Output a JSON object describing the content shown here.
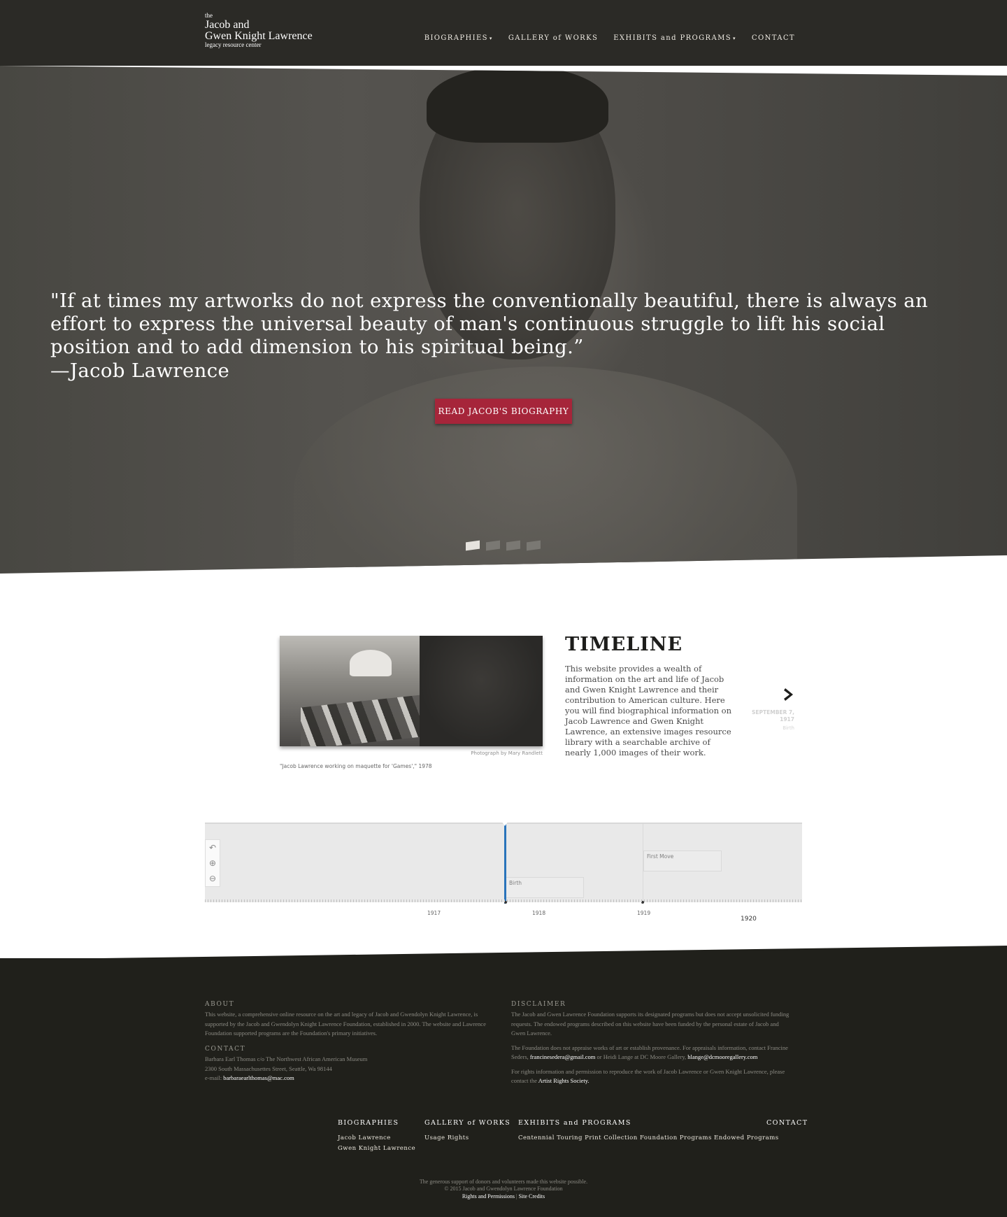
{
  "logo": {
    "line1": "the",
    "line2": "Jacob and",
    "line3": "Gwen Knight Lawrence",
    "line4": "legacy resource center"
  },
  "nav": {
    "biographies": "BIOGRAPHIES",
    "gallery": "GALLERY of WORKS",
    "exhibits": "EXHIBITS and PROGRAMS",
    "contact": "CONTACT",
    "caret": "▾"
  },
  "hero": {
    "quote": "\"If at times my artworks do not express the conventionally beautiful, there is always an effort to express the universal beauty of man's continuous struggle to lift his social position and to add dimension to his spiritual being.”",
    "author": "—Jacob Lawrence",
    "button": "READ JACOB'S BIOGRAPHY",
    "slides": 4,
    "active_slide": 1
  },
  "timeline_intro": {
    "title": "TIMELINE",
    "text": "This website provides a wealth of information on the art and life of Jacob and Gwen Knight Lawrence and their contribution to American culture. Here you will find biographical information on Jacob Lawrence and Gwen Knight Lawrence, an extensive images resource library with a searchable archive of nearly 1,000 images of their work.",
    "photo_credit": "Photograph by Mary Randlett",
    "photo_caption": "\"Jacob Lawrence working on maquette for 'Games',\" 1978",
    "next_date": "SEPTEMBER 7, 1917",
    "next_label": "Birth",
    "next_icon": "chevron-right-icon"
  },
  "timeline_nav": {
    "controls": [
      "↶",
      "⊕",
      "⊖"
    ],
    "events": [
      "Birth",
      "First Move"
    ],
    "years": [
      "1917",
      "1918",
      "1919",
      "1920"
    ]
  },
  "footer": {
    "about_head": "ABOUT",
    "about_text": "This website, a comprehensive online resource on the art and legacy of Jacob and Gwendolyn Knight Lawrence, is supported by the Jacob and Gwendolyn Knight Lawrence Foundation, established in 2000. The website and Lawrence Foundation supported programs are the Foundation's primary initiatives.",
    "contact_head": "CONTACT",
    "contact_line1": "Barbara Earl Thomas c/o The Northwest African American Museum",
    "contact_line2": "2300 South Massachusettes Street, Seattle, Wa 98144",
    "contact_email_label": "e-mail:",
    "contact_email": "barbaraearlthomas@mac.com",
    "disclaimer_head": "DISCLAIMER",
    "disclaimer_p1": "The Jacob and Gwen Lawrence Foundation supports its designated programs but does not accept unsolicited funding requests. The endowed programs described on this website have been funded by the personal estate of Jacob and Gwen Lawrence.",
    "disclaimer_p2a": "The Foundation does not appraise works of art or establish provenance. For appraisals information, contact Francine Seders,",
    "disclaimer_email1": "francinesedera@gmail.com",
    "disclaimer_p2b": "or Heidi Lange at DC Moore Gallery,",
    "disclaimer_email2": "hlange@dcmooregallery.com",
    "disclaimer_p3a": "For rights information and permission to reproduce the work of Jacob Lawrence or Gwen Knight Lawrence, please contact the",
    "disclaimer_p3link": "Artist Rights Society.",
    "nav_bio": "BIOGRAPHIES",
    "nav_bio_1": "Jacob Lawrence",
    "nav_bio_2": "Gwen Knight Lawrence",
    "nav_gallery": "GALLERY of WORKS",
    "nav_gallery_1": "Usage Rights",
    "nav_exhibits": "EXHIBITS and PROGRAMS",
    "nav_exhibits_1": "Centennial Touring Print Collection",
    "nav_exhibits_2": "Foundation Programs",
    "nav_exhibits_3": "Endowed Programs",
    "nav_contact": "CONTACT",
    "bottom_1": "The generous support of donors and volunteers made this website possible.",
    "bottom_2": "© 2015 Jacob and Gwendolyn Lawrence Foundation",
    "bottom_rights": "Rights and Permissions",
    "bottom_sep": "|",
    "bottom_credits": "Site Credits"
  }
}
